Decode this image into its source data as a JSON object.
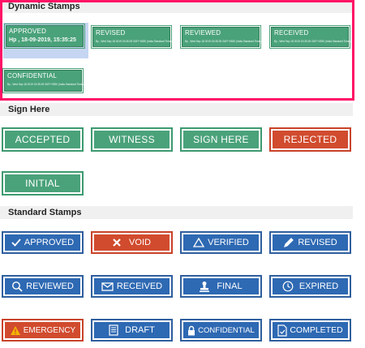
{
  "sections": {
    "dynamic": "Dynamic Stamps",
    "sign": "Sign Here",
    "standard": "Standard Stamps"
  },
  "dynamic_stamps": [
    {
      "title": "APPROVED",
      "subtitle": "Hp , 18-09-2019, 15:35:25"
    },
    {
      "title": "REVISED",
      "subtitle": "By , Wed Sep 18 2019 15:35:25 GMT+0530 (India Standard Time)"
    },
    {
      "title": "REVIEWED",
      "subtitle": "By , Wed Sep 18 2019 15:35:25 GMT+0530 (India Standard Time)"
    },
    {
      "title": "RECEIVED",
      "subtitle": "By , Wed Sep 18 2019 15:35:25 GMT+0530 (India Standard Time)"
    },
    {
      "title": "CONFIDENTIAL",
      "subtitle": "By , Wed Sep 18 2019 15:35:25 GMT+0530 (India Standard Time)"
    }
  ],
  "sign_stamps": [
    "ACCEPTED",
    "WITNESS",
    "SIGN HERE",
    "REJECTED",
    "INITIAL"
  ],
  "standard_stamps": [
    {
      "label": "APPROVED",
      "icon": "checkmark-icon"
    },
    {
      "label": "VOID",
      "icon": "x-icon"
    },
    {
      "label": "VERIFIED",
      "icon": "triangle-icon"
    },
    {
      "label": "REVISED",
      "icon": "pencil-icon"
    },
    {
      "label": "REVIEWED",
      "icon": "magnifier-icon"
    },
    {
      "label": "RECEIVED",
      "icon": "envelope-icon"
    },
    {
      "label": "FINAL",
      "icon": "stamp-icon"
    },
    {
      "label": "EXPIRED",
      "icon": "clock-icon"
    },
    {
      "label": "EMERGENCY",
      "icon": "warning-icon"
    },
    {
      "label": "DRAFT",
      "icon": "document-icon"
    },
    {
      "label": "CONFIDENTIAL",
      "icon": "lock-icon"
    },
    {
      "label": "COMPLETED",
      "icon": "completed-doc-icon"
    }
  ],
  "colors": {
    "green": "#4aa27a",
    "red": "#d14b2e",
    "blue": "#2e69b3",
    "highlight": "#ff1166",
    "selection": "#c6d6f2"
  }
}
